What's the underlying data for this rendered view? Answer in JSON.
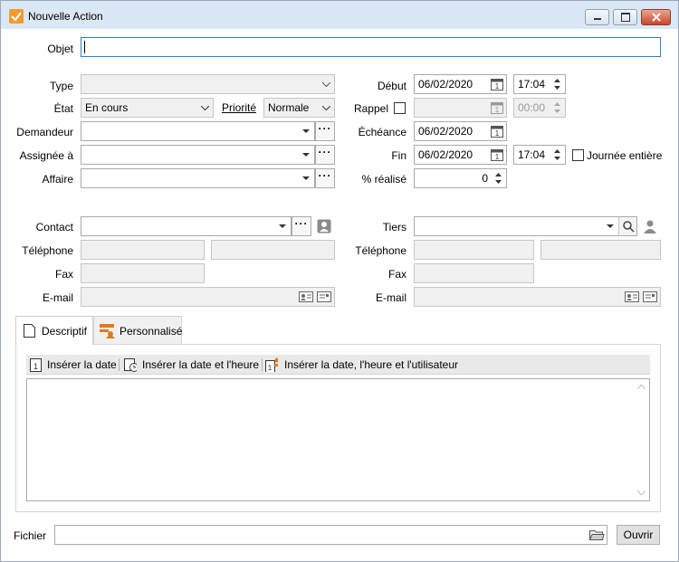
{
  "window": {
    "title": "Nouvelle Action"
  },
  "objet": {
    "label": "Objet",
    "value": ""
  },
  "type": {
    "label": "Type",
    "value": ""
  },
  "etat": {
    "label": "État",
    "value": "En cours"
  },
  "priorite": {
    "label": "Priorité",
    "value": "Normale"
  },
  "demandeur": {
    "label": "Demandeur",
    "value": ""
  },
  "assignee": {
    "label": "Assignée à",
    "value": ""
  },
  "affaire": {
    "label": "Affaire",
    "value": ""
  },
  "debut": {
    "label": "Début",
    "date": "06/02/2020",
    "time": "17:04"
  },
  "rappel": {
    "label": "Rappel",
    "date": "",
    "time": "00:00",
    "checked": false
  },
  "echeance": {
    "label": "Échéance",
    "date": "06/02/2020"
  },
  "fin": {
    "label": "Fin",
    "date": "06/02/2020",
    "time": "17:04"
  },
  "journee_entiere": {
    "label": "Journée entière",
    "checked": false
  },
  "pct_realise": {
    "label": "% réalisé",
    "value": "0"
  },
  "contact": {
    "label": "Contact",
    "value": "",
    "telephone_label": "Téléphone",
    "telephone1": "",
    "telephone2": "",
    "fax_label": "Fax",
    "fax": "",
    "email_label": "E-mail",
    "email": ""
  },
  "tiers": {
    "label": "Tiers",
    "value": "",
    "telephone_label": "Téléphone",
    "telephone1": "",
    "telephone2": "",
    "fax_label": "Fax",
    "fax": "",
    "email_label": "E-mail",
    "email": ""
  },
  "tabs": [
    {
      "label": "Descriptif",
      "active": true
    },
    {
      "label": "Personnalisé",
      "active": false
    }
  ],
  "toolbar": {
    "insert_date": "Insérer la date",
    "insert_date_time": "Insérer la date et l'heure",
    "insert_date_time_user": "Insérer la date, l'heure et l'utilisateur"
  },
  "descriptif_text": "",
  "fichier": {
    "label": "Fichier",
    "value": "",
    "open_label": "Ouvrir"
  },
  "colors": {
    "accent": "#2e7fbd",
    "app_icon": "#f29a2e",
    "titlebar": "#dae7f4"
  }
}
